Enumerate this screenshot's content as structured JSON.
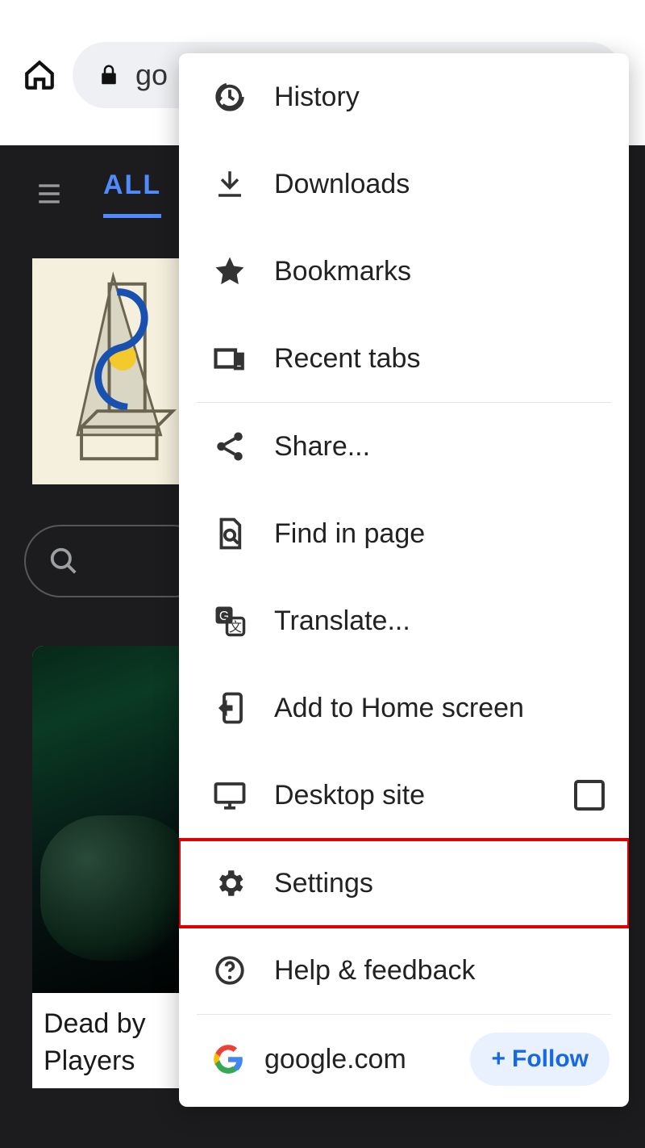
{
  "browser": {
    "url_fragment": "go"
  },
  "page": {
    "tab_all": "ALL",
    "news_headline": "Dead by\nPlayers "
  },
  "menu": {
    "history": "History",
    "downloads": "Downloads",
    "bookmarks": "Bookmarks",
    "recent_tabs": "Recent tabs",
    "share": "Share...",
    "find_in_page": "Find in page",
    "translate": "Translate...",
    "add_to_home": "Add to Home screen",
    "desktop_site": "Desktop site",
    "settings": "Settings",
    "help_feedback": "Help & feedback"
  },
  "site": {
    "domain": "google.com",
    "follow": "Follow"
  }
}
